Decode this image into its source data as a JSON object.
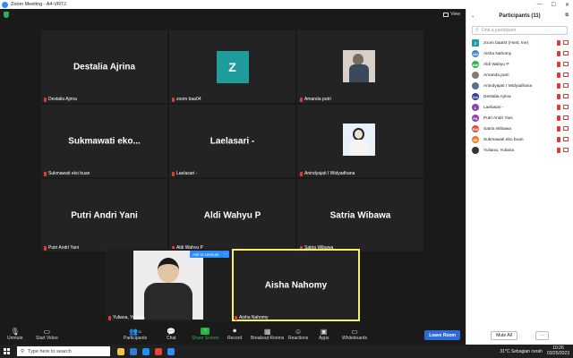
{
  "window": {
    "title": "Zoom Meeting - A4-VR7J",
    "view_label": "View",
    "minimize": "—",
    "maximize": "☐",
    "close": "✕"
  },
  "tiles": [
    {
      "big_name": "Destalia Ajrina",
      "label": "Destalia Ajrina"
    },
    {
      "avatar_letter": "Z",
      "label": "zoom baa04"
    },
    {
      "label": "Amanda putri"
    },
    {
      "big_name": "Sukmawati eko...",
      "label": "Sukmawati eko buan"
    },
    {
      "big_name": "Laelasari -",
      "label": "Laelasari -"
    },
    {
      "label": "Anindyajati I Widyadhana"
    },
    {
      "big_name": "Putri Andri Yani",
      "label": "Putri Andri Yani"
    },
    {
      "big_name": "Aldi Wahyu P",
      "label": "Aldi Wahyu P"
    },
    {
      "big_name": "Satria Wibawa",
      "label": "Satria Wibawa"
    },
    {
      "label": "Yuliana, Yuliana"
    },
    {
      "big_name": "Aisha Nahomy",
      "label": "Aisha Nahomy"
    }
  ],
  "ask_to_unmute": "Ask to Unmute",
  "more_dots": "···",
  "toolbar": {
    "unmute": "Unmute",
    "start_video": "Start Video",
    "participants": "Participants",
    "participants_count": "11",
    "chat": "Chat",
    "share_screen": "Share Screen",
    "record": "Record",
    "breakout_rooms": "Breakout Rooms",
    "reactions": "Reactions",
    "apps": "Apps",
    "whiteboards": "Whiteboards",
    "leave": "Leave Room"
  },
  "panel": {
    "title": "Participants (11)",
    "search_placeholder": "Find a participant",
    "mute_all": "Mute All",
    "more": "···",
    "participants": [
      {
        "initials": "Z",
        "name": "zoom baa04 (Host, me)",
        "color": "#1f9d9d",
        "square": true
      },
      {
        "initials": "AN",
        "name": "Aisha Nahomy",
        "color": "#4a86c5"
      },
      {
        "initials": "AW",
        "name": "Aldi Wahyu P",
        "color": "#2bb24c"
      },
      {
        "initials": "",
        "name": "Amanda putri",
        "color": "#8a7a6b"
      },
      {
        "initials": "",
        "name": "Anindyajati I Widyadhana",
        "color": "#5a6e8c"
      },
      {
        "initials": "DA",
        "name": "Destalia Ajrina",
        "color": "#2c3e8f"
      },
      {
        "initials": "L",
        "name": "Laelasari -",
        "color": "#8e44ad"
      },
      {
        "initials": "PA",
        "name": "Putri Andri Yani",
        "color": "#8e44ad"
      },
      {
        "initials": "SW",
        "name": "Satria Wibawa",
        "color": "#e74c3c"
      },
      {
        "initials": "SE",
        "name": "Sukmawati eko buan",
        "color": "#e67e22"
      },
      {
        "initials": "",
        "name": "Yuliana, Yuliana",
        "color": "#333333"
      }
    ]
  },
  "taskbar": {
    "search_placeholder": "Type here to search",
    "weather": "31°C  Sebagian cerah",
    "time": "10:26",
    "date": "03/25/2023"
  }
}
